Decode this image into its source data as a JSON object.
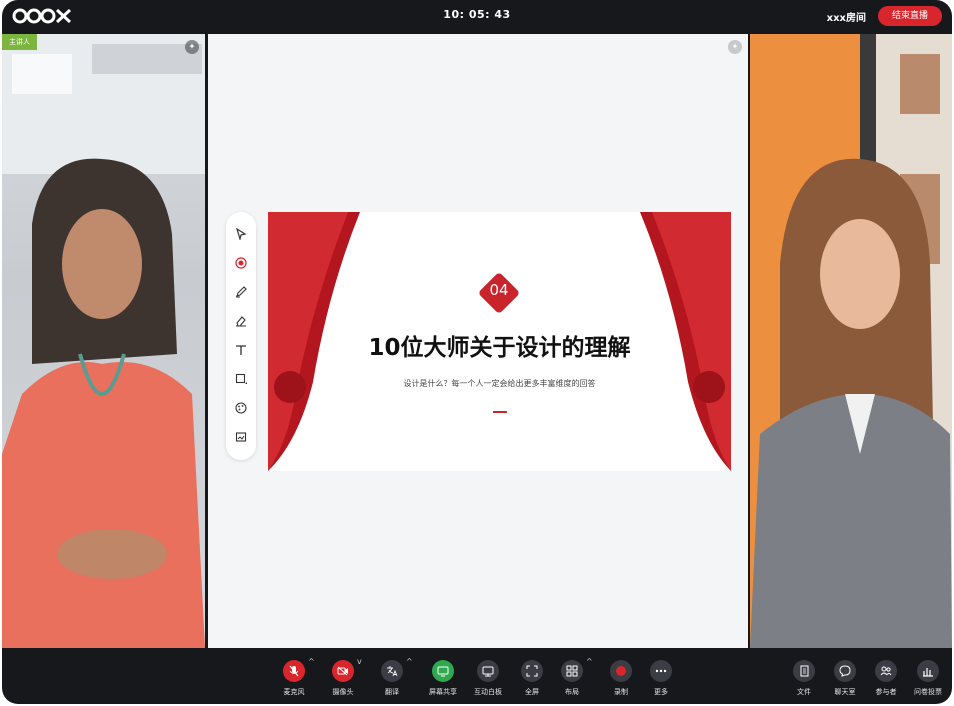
{
  "topbar": {
    "clock": "10: 05: 43",
    "room_name": "xxx房间",
    "end_button": "结束直播"
  },
  "left_tile": {
    "presenter_label": "主讲人"
  },
  "slide": {
    "badge": "04",
    "title": "10位大师关于设计的理解",
    "subtitle": "设计是什么？每一个人一定会给出更多丰富维度的回答"
  },
  "toolbox": {
    "tools": [
      "pointer-icon",
      "laser-icon",
      "pen-icon",
      "eraser-icon",
      "text-icon",
      "shape-icon",
      "palette-icon",
      "image-icon"
    ]
  },
  "controls": [
    {
      "label": "麦克风",
      "icon": "mic-off-icon",
      "color": "#d9262c"
    },
    {
      "label": "摄像头",
      "icon": "camera-off-icon",
      "color": "#d9262c"
    },
    {
      "label": "翻译",
      "icon": "translate-icon",
      "color": "#3a3d43"
    },
    {
      "label": "屏幕共享",
      "icon": "screen-share-icon",
      "color": "#2fa84f"
    },
    {
      "label": "互动白板",
      "icon": "whiteboard-icon",
      "color": "#3a3d43"
    },
    {
      "label": "全屏",
      "icon": "fullscreen-icon",
      "color": "#3a3d43"
    },
    {
      "label": "布局",
      "icon": "layout-icon",
      "color": "#3a3d43"
    },
    {
      "label": "录制",
      "icon": "record-icon",
      "color": "#3a3d43"
    },
    {
      "label": "更多",
      "icon": "more-icon",
      "color": "#3a3d43"
    }
  ],
  "side_controls": [
    {
      "label": "文件",
      "icon": "file-icon"
    },
    {
      "label": "聊天室",
      "icon": "chat-icon"
    },
    {
      "label": "参与者",
      "icon": "participants-icon"
    },
    {
      "label": "问卷投票",
      "icon": "poll-icon"
    }
  ],
  "colors": {
    "accent_red": "#d9262c",
    "share_green": "#2fa84f",
    "presenter_green": "#7cb63e"
  }
}
